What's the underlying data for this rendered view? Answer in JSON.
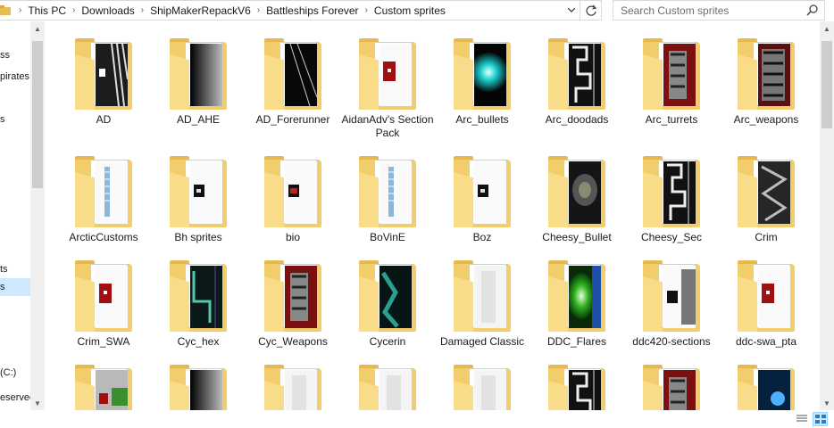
{
  "address_bar": {
    "breadcrumbs": [
      "This PC",
      "Downloads",
      "ShipMakerRepackV6",
      "Battleships Forever",
      "Custom sprites"
    ]
  },
  "search": {
    "placeholder": "Search Custom sprites"
  },
  "nav": {
    "items": [
      {
        "label": "ss",
        "selected": false
      },
      {
        "label": "pirates",
        "selected": false
      },
      {
        "label": "s",
        "selected": false
      },
      {
        "label": "ts",
        "selected": false
      },
      {
        "label": "s",
        "selected": true
      },
      {
        "label": "(C:)",
        "selected": false
      },
      {
        "label": "eserved",
        "selected": false
      }
    ]
  },
  "folders": [
    {
      "label": "AD",
      "thumb": "stripe-bw",
      "row": 1
    },
    {
      "label": "AD_AHE",
      "thumb": "gradient-dark",
      "row": 1
    },
    {
      "label": "AD_Forerunner",
      "thumb": "dark-lines",
      "row": 1
    },
    {
      "label": "AidanAdv's Section Pack",
      "thumb": "red-square",
      "row": 1
    },
    {
      "label": "Arc_bullets",
      "thumb": "cyan-glow",
      "row": 1
    },
    {
      "label": "Arc_doodads",
      "thumb": "circuit-bw",
      "row": 1
    },
    {
      "label": "Arc_turrets",
      "thumb": "red-gray",
      "row": 1
    },
    {
      "label": "Arc_weapons",
      "thumb": "gray-red",
      "row": 1
    },
    {
      "label": "ArcticCustoms",
      "thumb": "blue-strip",
      "row": 2
    },
    {
      "label": "Bh sprites",
      "thumb": "black-spot",
      "row": 2
    },
    {
      "label": "bio",
      "thumb": "black-red",
      "row": 2
    },
    {
      "label": "BoVinE",
      "thumb": "blue-strip",
      "row": 2
    },
    {
      "label": "Boz",
      "thumb": "black-spot",
      "row": 2
    },
    {
      "label": "Cheesy_Bullet",
      "thumb": "dark-blur",
      "row": 2
    },
    {
      "label": "Cheesy_Sec",
      "thumb": "circuit-bw",
      "row": 2
    },
    {
      "label": "Crim",
      "thumb": "mesh-gray",
      "row": 2
    },
    {
      "label": "Crim_SWA",
      "thumb": "red-square",
      "row": 3
    },
    {
      "label": "Cyc_hex",
      "thumb": "teal-circuit",
      "row": 3
    },
    {
      "label": "Cyc_Weapons",
      "thumb": "red-gray",
      "row": 3
    },
    {
      "label": "Cycerin",
      "thumb": "teal-dark",
      "row": 3
    },
    {
      "label": "Damaged Classic",
      "thumb": "light-gray",
      "row": 3
    },
    {
      "label": "DDC_Flares",
      "thumb": "green-glow",
      "row": 3
    },
    {
      "label": "ddc420-sections",
      "thumb": "black-spot-gray",
      "row": 3
    },
    {
      "label": "ddc-swa_pta",
      "thumb": "red-square",
      "row": 3
    },
    {
      "label": "",
      "thumb": "red-green",
      "row": 4
    },
    {
      "label": "",
      "thumb": "gradient-dark",
      "row": 4
    },
    {
      "label": "",
      "thumb": "light-gray",
      "row": 4
    },
    {
      "label": "",
      "thumb": "light-gray",
      "row": 4
    },
    {
      "label": "",
      "thumb": "light-gray",
      "row": 4
    },
    {
      "label": "",
      "thumb": "circuit-bw",
      "row": 4
    },
    {
      "label": "",
      "thumb": "red-gray",
      "row": 4
    },
    {
      "label": "",
      "thumb": "blue-glow",
      "row": 4
    }
  ],
  "colors": {
    "folder_back": "#f2cd6c",
    "folder_front": "#f8dc8a",
    "selection": "#cde8ff",
    "scrollbar_thumb": "#cdcdcd"
  }
}
